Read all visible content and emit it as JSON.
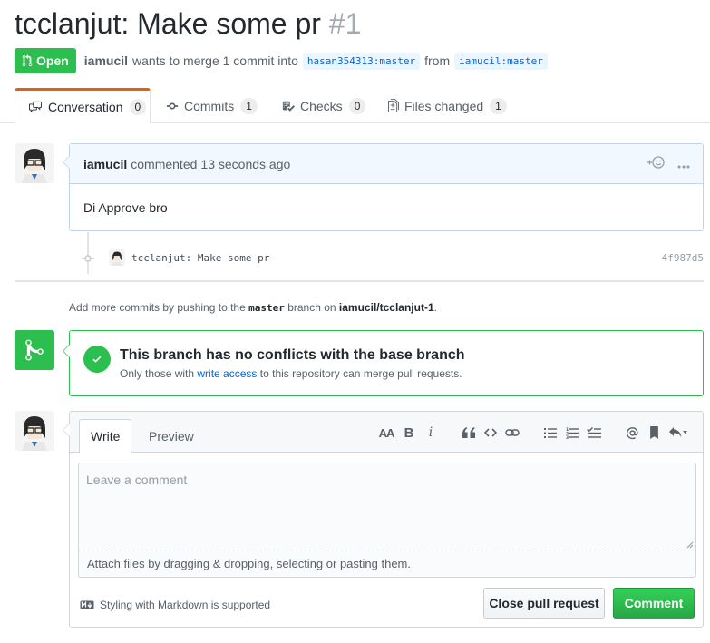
{
  "pr": {
    "title": "tcclanjut: Make some pr",
    "number": "#1",
    "state": "Open",
    "author": "iamucil",
    "merge_text": "wants to merge 1 commit into",
    "base_branch": "hasan354313:master",
    "from_word": "from",
    "head_branch": "iamucil:master"
  },
  "tabs": [
    {
      "label": "Conversation",
      "count": "0",
      "icon": "comment-discussion-icon"
    },
    {
      "label": "Commits",
      "count": "1",
      "icon": "git-commit-icon"
    },
    {
      "label": "Checks",
      "count": "0",
      "icon": "checklist-icon"
    },
    {
      "label": "Files changed",
      "count": "1",
      "icon": "file-diff-icon"
    }
  ],
  "comment": {
    "author": "iamucil",
    "action": "commented",
    "time": "13 seconds ago",
    "body": "Di Approve bro"
  },
  "commit": {
    "message": "tcclanjut: Make some pr",
    "sha": "4f987d5"
  },
  "hint": {
    "prefix": "Add more commits by pushing to the",
    "branch": "master",
    "middle": "branch on",
    "repo": "iamucil/tcclanjut-1",
    "suffix": "."
  },
  "merge": {
    "title": "This branch has no conflicts with the base branch",
    "sub_prefix": "Only those with",
    "sub_link": "write access",
    "sub_suffix": "to this repository can merge pull requests."
  },
  "editor": {
    "write_tab": "Write",
    "preview_tab": "Preview",
    "placeholder": "Leave a comment",
    "attach_text": "Attach files by dragging & dropping, selecting or pasting them.",
    "markdown_hint": "Styling with Markdown is supported",
    "close_button": "Close pull request",
    "comment_button": "Comment",
    "toolbar_heading": "AA",
    "toolbar_bold": "B",
    "toolbar_italic": "i"
  },
  "colors": {
    "open_green": "#2cbe4e",
    "tab_accent": "#e36209",
    "link_blue": "#0366d6"
  }
}
